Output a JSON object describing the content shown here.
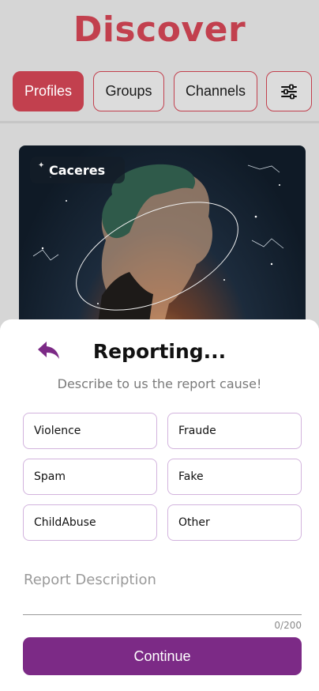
{
  "header": {
    "title": "Discover"
  },
  "tabs": [
    {
      "label": "Profiles",
      "active": true
    },
    {
      "label": "Groups",
      "active": false
    },
    {
      "label": "Channels",
      "active": false
    }
  ],
  "filter_button": {
    "icon": "sliders-icon"
  },
  "profile_card": {
    "name": "Caceres"
  },
  "report_sheet": {
    "title": "Reporting...",
    "subtitle": "Describe to us the report cause!",
    "options": [
      "Violence",
      "Fraude",
      "Spam",
      "Fake",
      "ChildAbuse",
      "Other"
    ],
    "description_placeholder": "Report Description",
    "counter": "0/200",
    "continue_label": "Continue"
  },
  "colors": {
    "brand_red": "#c2404e",
    "accent_purple": "#7c2a86",
    "option_border": "#d2b3dd"
  }
}
